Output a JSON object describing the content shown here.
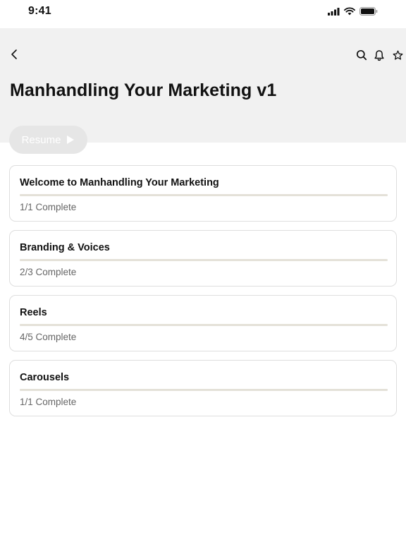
{
  "status_bar": {
    "time": "9:41",
    "icons": [
      "cellular-signal-icon",
      "wifi-icon",
      "battery-icon"
    ]
  },
  "header": {
    "title": "Manhandling Your Marketing v1",
    "icons": {
      "back": "chevron-left-icon",
      "search": "search-icon",
      "notifications": "bell-icon",
      "favorite": "star-icon"
    }
  },
  "resume": {
    "label": "Resume",
    "icon": "play-icon"
  },
  "sections": [
    {
      "title": "Welcome to Manhandling Your Marketing",
      "status": "1/1 Complete",
      "progress": 1.0
    },
    {
      "title": "Branding & Voices",
      "status": "2/3 Complete",
      "progress": 0.6667
    },
    {
      "title": "Reels",
      "status": "4/5 Complete",
      "progress": 0.8
    },
    {
      "title": "Carousels",
      "status": "1/1 Complete",
      "progress": 1.0
    }
  ],
  "colors": {
    "header_bg": "#f1f1f1",
    "progress_track": "#e4e1d8",
    "resume_bg": "#e6e6e6",
    "card_border": "#dedede"
  }
}
